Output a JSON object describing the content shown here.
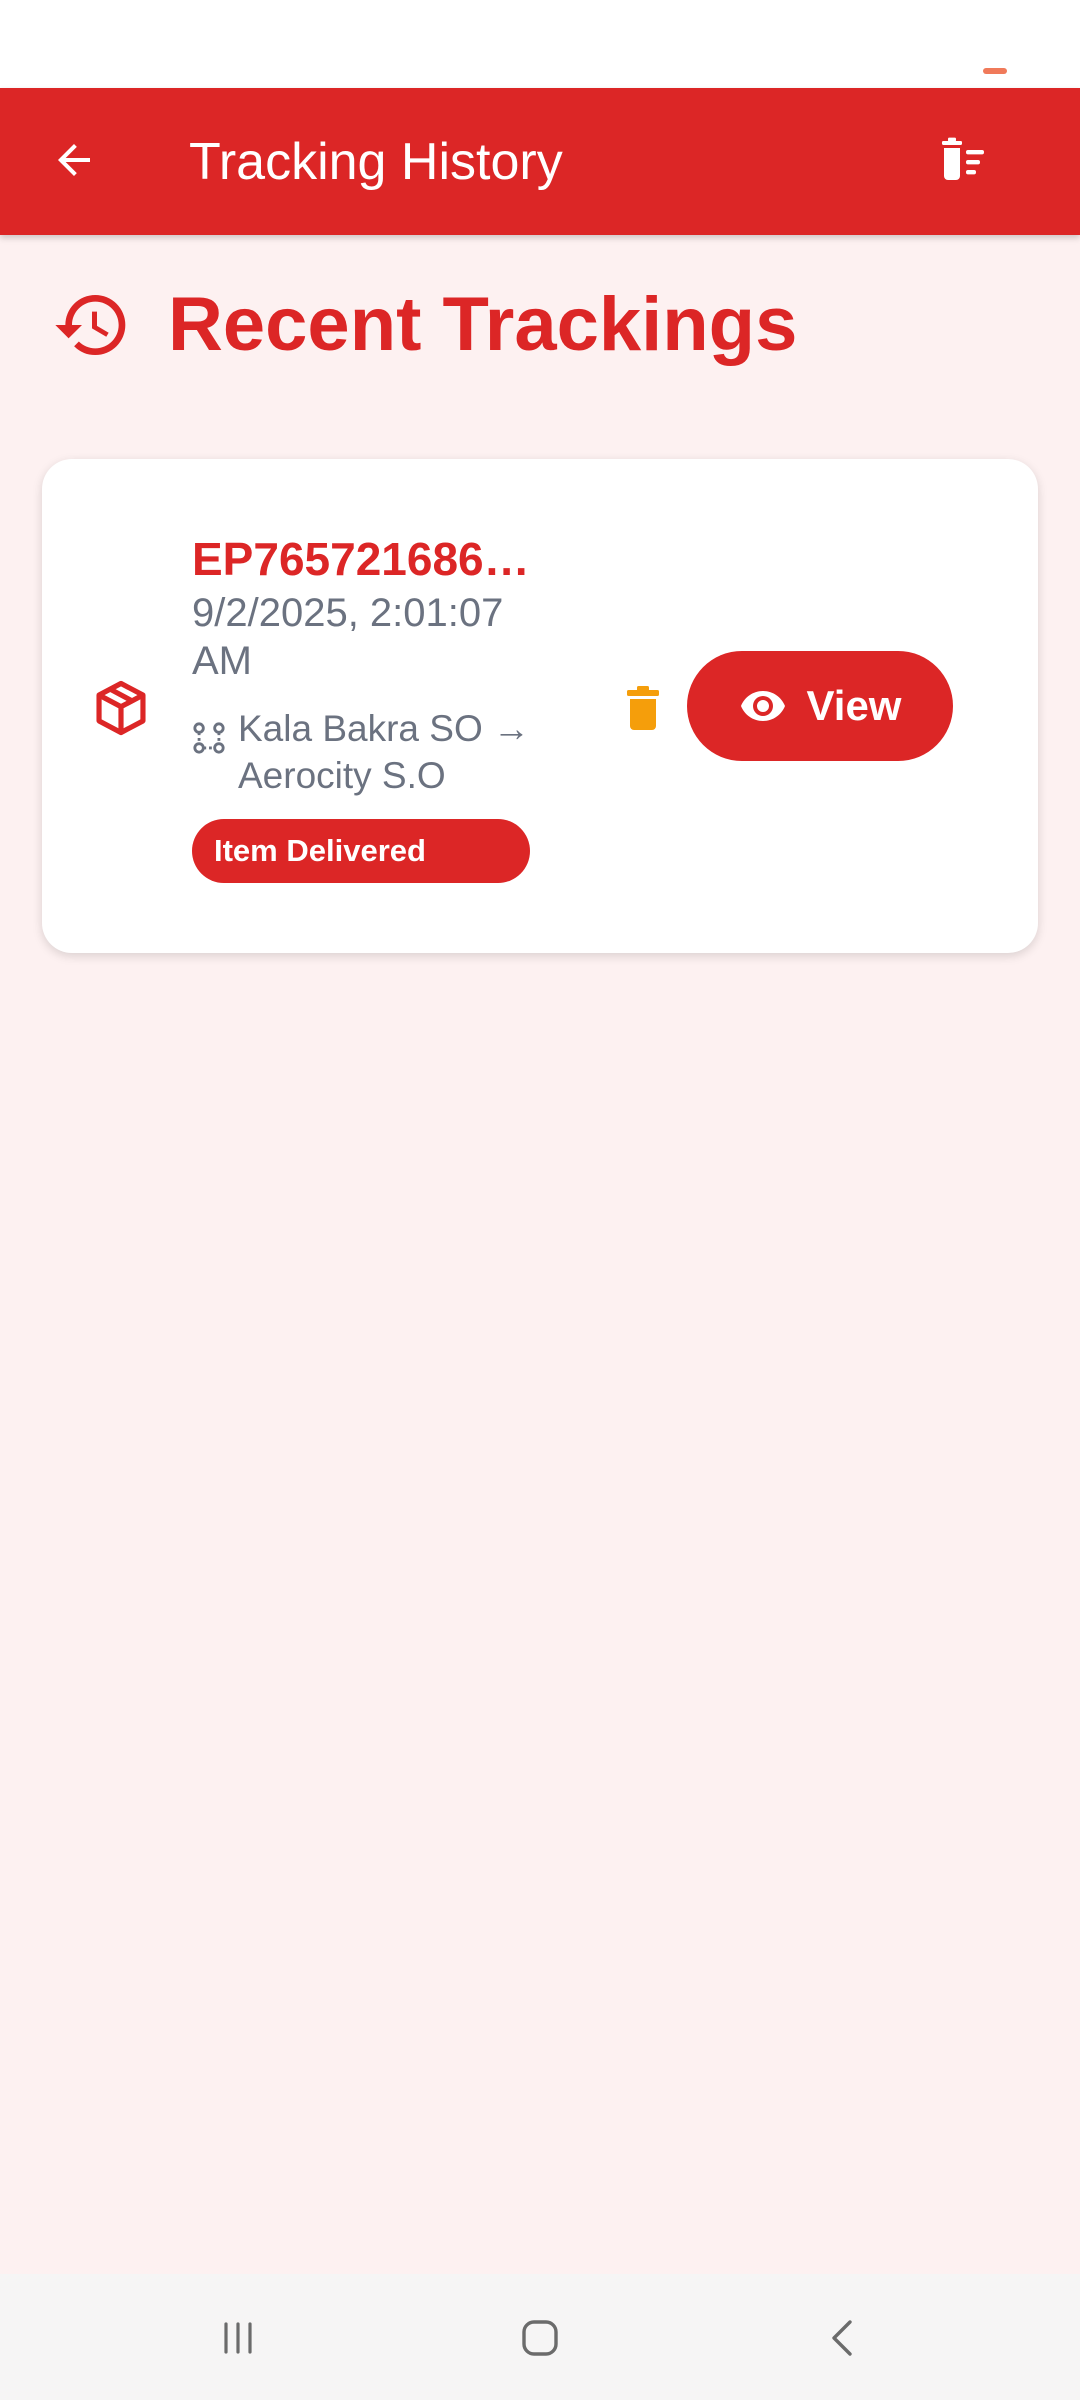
{
  "app_bar": {
    "title": "Tracking History",
    "back_icon": "arrow-left-icon",
    "clear_icon": "clear-all-trash-icon"
  },
  "section": {
    "heading": "Recent Trackings",
    "icon": "history-icon"
  },
  "history": [
    {
      "tracking_id": "EP765721686…",
      "date": "9/2/2025, 2:01:07 AM",
      "route": "Kala Bakra SO → Aerocity S.O",
      "status": "Item Delivered",
      "view_label": "View"
    }
  ],
  "colors": {
    "primary": "#dc2626",
    "background": "#fdf1f1",
    "muted_text": "#6b7280",
    "delete": "#f59e0b"
  },
  "nav": {
    "recents_icon": "recent-apps-icon",
    "home_icon": "home-icon",
    "back_icon": "back-chevron-icon"
  }
}
